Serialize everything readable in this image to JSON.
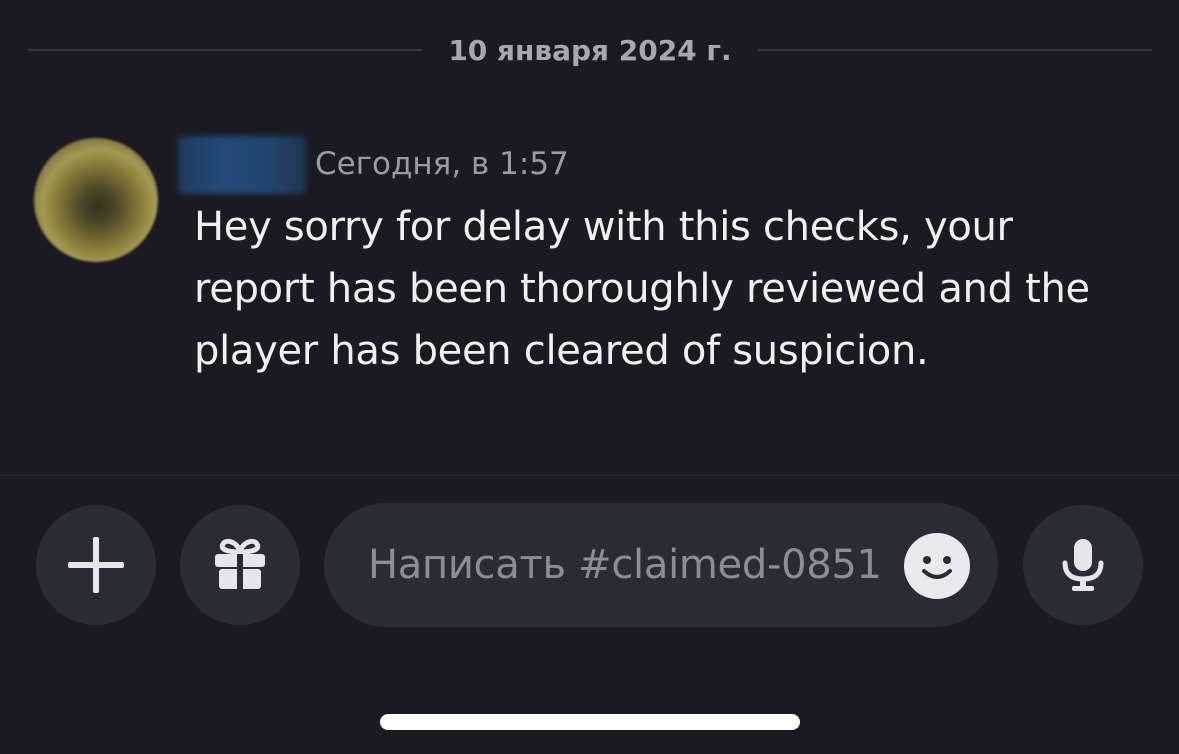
{
  "chat": {
    "date_divider": "10 января 2024 г.",
    "message": {
      "timestamp": "Сегодня, в 1:57",
      "lines": [
        "Hey sorry for delay with this checks, your",
        "report has been thoroughly reviewed and the",
        "player has been cleared of suspicion."
      ]
    }
  },
  "composer": {
    "placeholder": "Написать #claimed-0851",
    "icons": {
      "add": "plus-icon",
      "gift": "gift-icon",
      "emoji": "emoji-icon",
      "mic": "microphone-icon"
    }
  },
  "colors": {
    "background": "#1a1a20",
    "input_background": "#2b2b33",
    "message_text": "#f0f0f3",
    "muted_text": "#9b9ba4"
  }
}
